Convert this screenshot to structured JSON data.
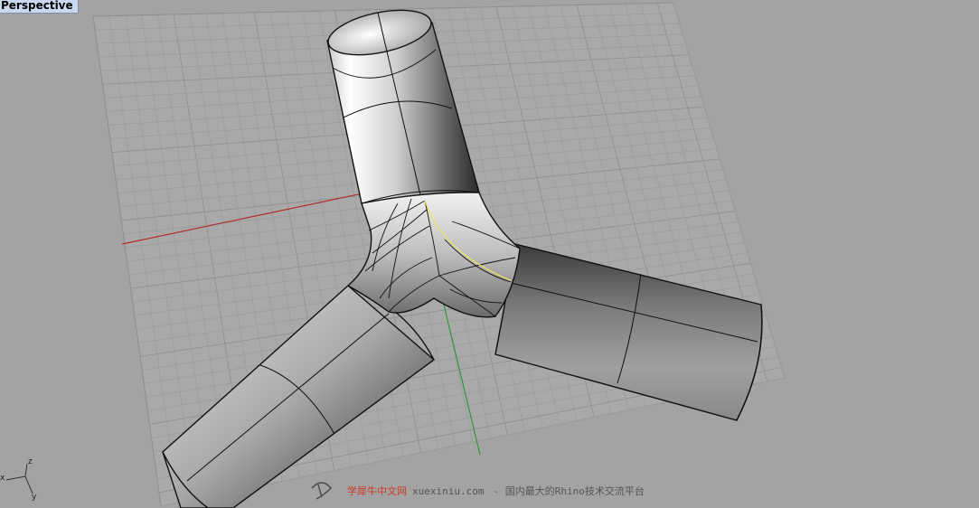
{
  "viewport": {
    "label": "Perspective"
  },
  "axis_icon": {
    "x_label": "x",
    "y_label": "y",
    "z_label": "z"
  },
  "watermark": {
    "brand": "学犀牛中文网",
    "site": "xuexiniu.com",
    "slogan": "- 国内最大的Rhino技术交流平台"
  },
  "colors": {
    "background": "#a3a3a3",
    "grid": "#9a9a9a",
    "x_axis": "#b03030",
    "y_axis": "#2f9a3a",
    "label_bg": "#c9d8ee",
    "highlight_curve": "#e8e860",
    "watermark_brand": "#cc3b2c"
  }
}
